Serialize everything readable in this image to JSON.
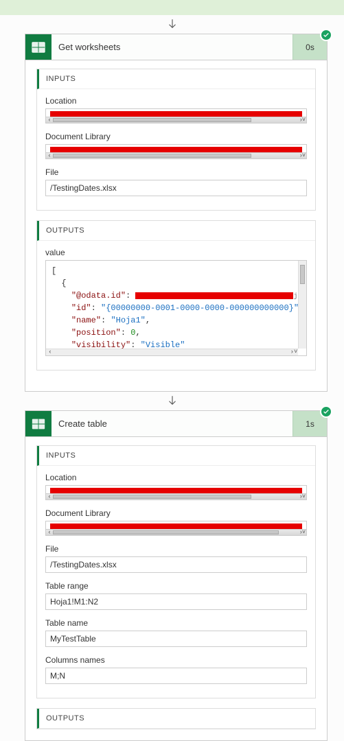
{
  "actions": [
    {
      "id": "get_worksheets",
      "title": "Get worksheets",
      "timing": "0s",
      "inputs_label": "INPUTS",
      "outputs_label": "OUTPUTS",
      "fields": {
        "location_label": "Location",
        "doclib_label": "Document Library",
        "file_label": "File",
        "file_value": "/TestingDates.xlsx",
        "value_label": "value"
      },
      "json": {
        "odata_key": "\"@odata.id\"",
        "id_key": "\"id\"",
        "id_val": "\"{00000000-0001-0000-0000-000000000000}\"",
        "name_key": "\"name\"",
        "name_val": "\"Hoja1\"",
        "position_key": "\"position\"",
        "position_val": "0",
        "visibility_key": "\"visibility\"",
        "visibility_val": "\"Visible\"",
        "trail": "jmhO"
      }
    },
    {
      "id": "create_table",
      "title": "Create table",
      "timing": "1s",
      "inputs_label": "INPUTS",
      "outputs_label": "OUTPUTS",
      "fields": {
        "location_label": "Location",
        "doclib_label": "Document Library",
        "file_label": "File",
        "file_value": "/TestingDates.xlsx",
        "range_label": "Table range",
        "range_value": "Hoja1!M1:N2",
        "tablename_label": "Table name",
        "tablename_value": "MyTestTable",
        "cols_label": "Columns names",
        "cols_value": "M;N"
      }
    }
  ],
  "glyphs": {
    "chev_l": "‹",
    "chev_r": "›",
    "chev_rr": "›˅"
  }
}
